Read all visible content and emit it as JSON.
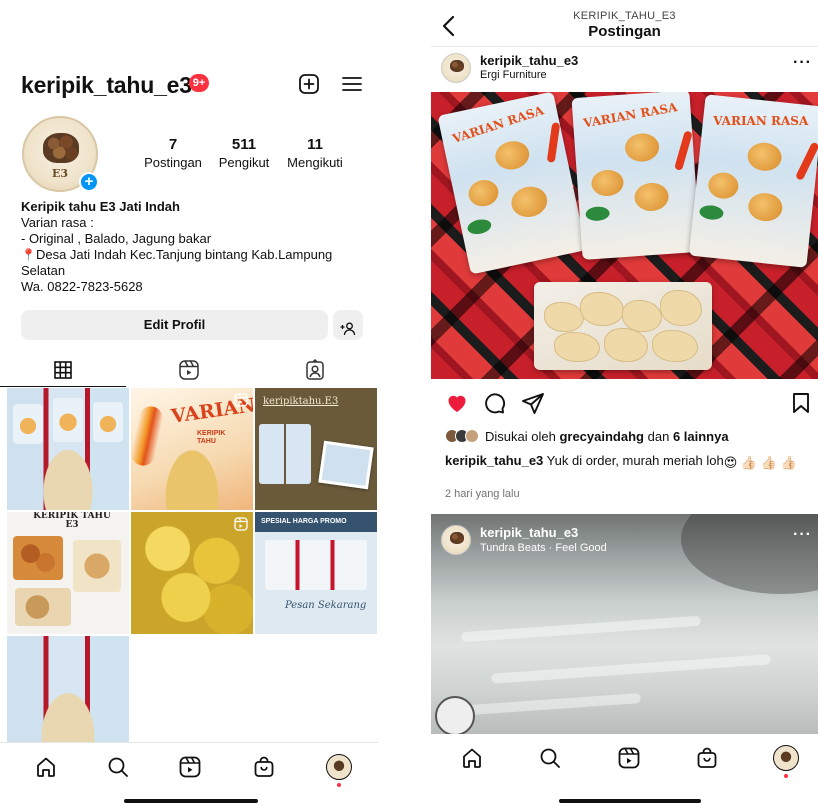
{
  "profile": {
    "username": "keripik_tahu_e3",
    "notification_badge": "9+",
    "avatar_text": "E3",
    "stats": [
      {
        "num": "7",
        "label": "Postingan"
      },
      {
        "num": "511",
        "label": "Pengikut"
      },
      {
        "num": "11",
        "label": "Mengikuti"
      }
    ],
    "bio": {
      "name": "Keripik tahu E3 Jati Indah",
      "line1": "Varian rasa :",
      "line2": "- Original , Balado, Jagung bakar",
      "line3": "Desa Jati Indah Kec.Tanjung bintang Kab.Lampung Selatan",
      "line4": "Wa. 0822-7823-5628"
    },
    "edit_button": "Edit Profil",
    "grid_texts": {
      "varian": "VARIAN",
      "keripik": "KERIPIK TAHU",
      "brand": "keripiktahu.E3",
      "e3_header": "KERIPIK TAHU E3",
      "promo": "SPESIAL HARGA PROMO",
      "pesan": "Pesan Sekarang"
    }
  },
  "post": {
    "header_sub": "KERIPIK_TAHU_E3",
    "header_title": "Postingan",
    "author": "keripik_tahu_e3",
    "author_sub": "Ergi Furniture",
    "pack_title": "VARIAN RASA",
    "liked_prefix": "Disukai oleh",
    "liked_by": "grecyaindahg",
    "liked_mid": "dan",
    "liked_others": "6 lainnya",
    "caption_user": "keripik_tahu_e3",
    "caption_text": "Yuk di order, murah meriah loh",
    "time": "2 hari yang lalu",
    "next_author": "keripik_tahu_e3",
    "next_sub": "Tundra Beats · Feel Good"
  },
  "colors": {
    "accent_blue": "#0095f6",
    "like_red": "#ed1c3c",
    "badge_red": "#ff3040"
  },
  "icons": {
    "left_header": [
      "plus-square-icon",
      "hamburger-menu-icon"
    ],
    "tabs": [
      "grid-icon",
      "reels-icon",
      "tagged-icon"
    ],
    "bottom_nav": [
      "home-icon",
      "search-icon",
      "reels-icon",
      "shop-icon",
      "profile-avatar-icon"
    ],
    "post_actions": [
      "heart-icon",
      "comment-icon",
      "share-icon",
      "bookmark-icon"
    ]
  }
}
